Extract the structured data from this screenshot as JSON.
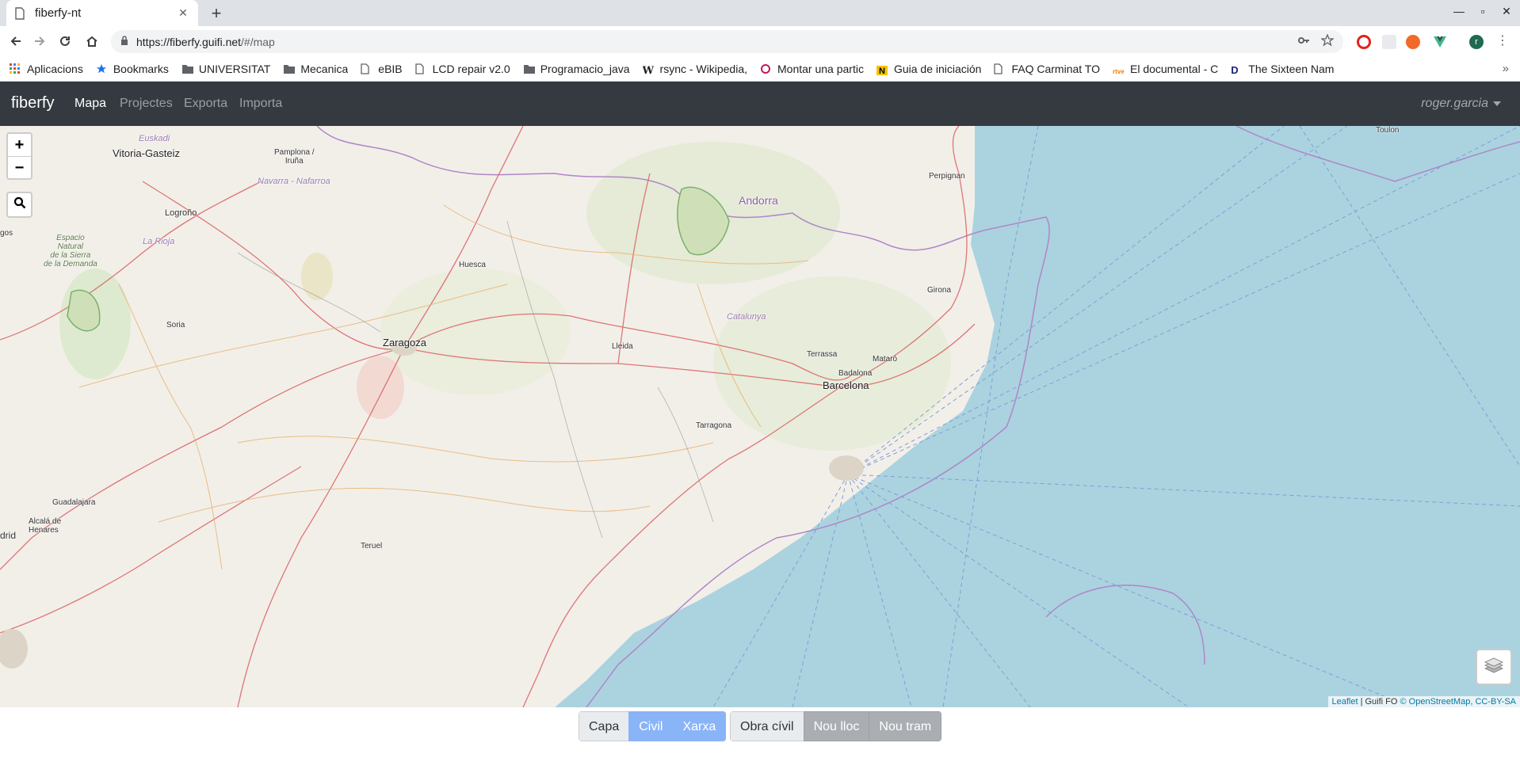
{
  "browser": {
    "tab_title": "fiberfy-nt",
    "url_host": "https://fiberfy.guifi.net",
    "url_path": "/#/map",
    "bookmarks": [
      {
        "label": "Aplicacions",
        "icon": "apps-grid-icon"
      },
      {
        "label": "Bookmarks",
        "icon": "star-icon"
      },
      {
        "label": "UNIVERSITAT",
        "icon": "folder-icon"
      },
      {
        "label": "Mecanica",
        "icon": "folder-icon"
      },
      {
        "label": "eBIB",
        "icon": "page-icon"
      },
      {
        "label": "LCD repair v2.0",
        "icon": "page-icon"
      },
      {
        "label": "Programacio_java",
        "icon": "folder-icon"
      },
      {
        "label": "rsync - Wikipedia,",
        "icon": "wikipedia-icon"
      },
      {
        "label": "Montar una partic",
        "icon": "site-icon"
      },
      {
        "label": "Guia de iniciación",
        "icon": "n-logo-icon"
      },
      {
        "label": "FAQ Carminat TO",
        "icon": "page-icon"
      },
      {
        "label": "El documental - C",
        "icon": "rtve-icon"
      },
      {
        "label": "The Sixteen Nam",
        "icon": "d-logo-icon"
      }
    ]
  },
  "navbar": {
    "brand": "fiberfy",
    "links": [
      "Mapa",
      "Projectes",
      "Exporta",
      "Importa"
    ],
    "active": "Mapa",
    "user": "roger.garcia"
  },
  "map": {
    "labels": {
      "euskadi": "Euskadi",
      "vitoria": "Vitoria-Gasteiz",
      "pamplona": "Pamplona /\nIruña",
      "navarra": "Navarra - Nafarroa",
      "logrono": "Logroño",
      "rioja": "La Rioja",
      "espacio": "Espacio\nNatural\nde la Sierra\nde la Demanda",
      "huesca": "Huesca",
      "andorra": "Andorra",
      "perpignan": "Perpignan",
      "toulon": "Toulon",
      "girona": "Girona",
      "soria": "Soria",
      "zaragoza": "Zaragoza",
      "lleida": "Lleida",
      "catalunya": "Catalunya",
      "terrassa": "Terrassa",
      "mataro": "Mataró",
      "badalona": "Badalona",
      "barcelona": "Barcelona",
      "tarragona": "Tarragona",
      "guadalajara": "Guadalajara",
      "alcala": "Alcalá de\nHenares",
      "madrid": "drid",
      "teruel": "Teruel",
      "gos": "gos"
    },
    "zoom_in": "+",
    "zoom_out": "−",
    "attribution": {
      "leaflet": "Leaflet",
      "sep1": " | Guifi FO ",
      "osm": "© OpenStreetMap, CC-BY-SA"
    }
  },
  "toolbar": {
    "group1": [
      "Capa",
      "Civil",
      "Xarxa"
    ],
    "group2": [
      "Obra cívil",
      "Nou lloc",
      "Nou tram"
    ]
  },
  "colors": {
    "sea": "#aad3df",
    "land": "#f2efe9",
    "navbar": "#343a40",
    "button_active": "#8ab4f8",
    "button_gray": "#aaaeb3"
  }
}
